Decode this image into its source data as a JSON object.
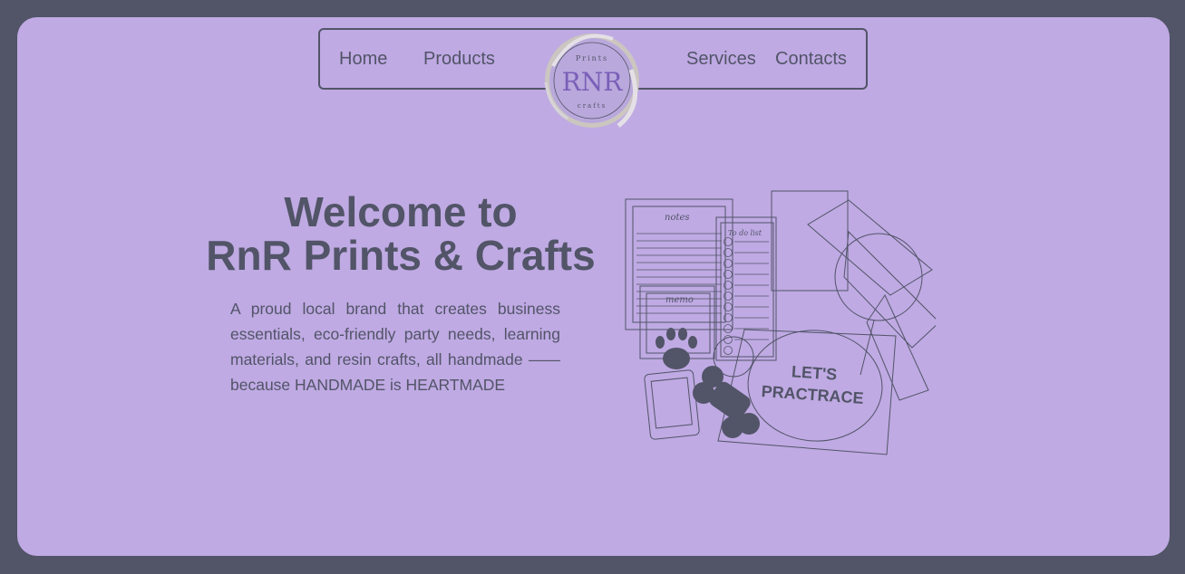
{
  "nav": {
    "items": [
      {
        "key": "home",
        "label": "Home"
      },
      {
        "key": "products",
        "label": "Products"
      },
      {
        "key": "services",
        "label": "Services"
      },
      {
        "key": "contacts",
        "label": "Contacts"
      }
    ]
  },
  "logo": {
    "top_text": "Prints",
    "monogram": "RNR",
    "bottom_text": "crafts"
  },
  "hero": {
    "title_line1": "Welcome to",
    "title_line2": "RnR Prints & Crafts",
    "description": "A proud local brand that creates business essentials, eco-friendly party needs, learning materials, and resin crafts, all handmade —— because HANDMADE is HEARTMADE"
  },
  "illustration": {
    "notes_label": "notes",
    "todo_label": "To do list",
    "memo_label": "memo",
    "sign_line1": "LET'S",
    "sign_line2": "PRACTRACE"
  },
  "colors": {
    "background": "#525468",
    "panel": "#bfaae3",
    "text": "#525468"
  }
}
